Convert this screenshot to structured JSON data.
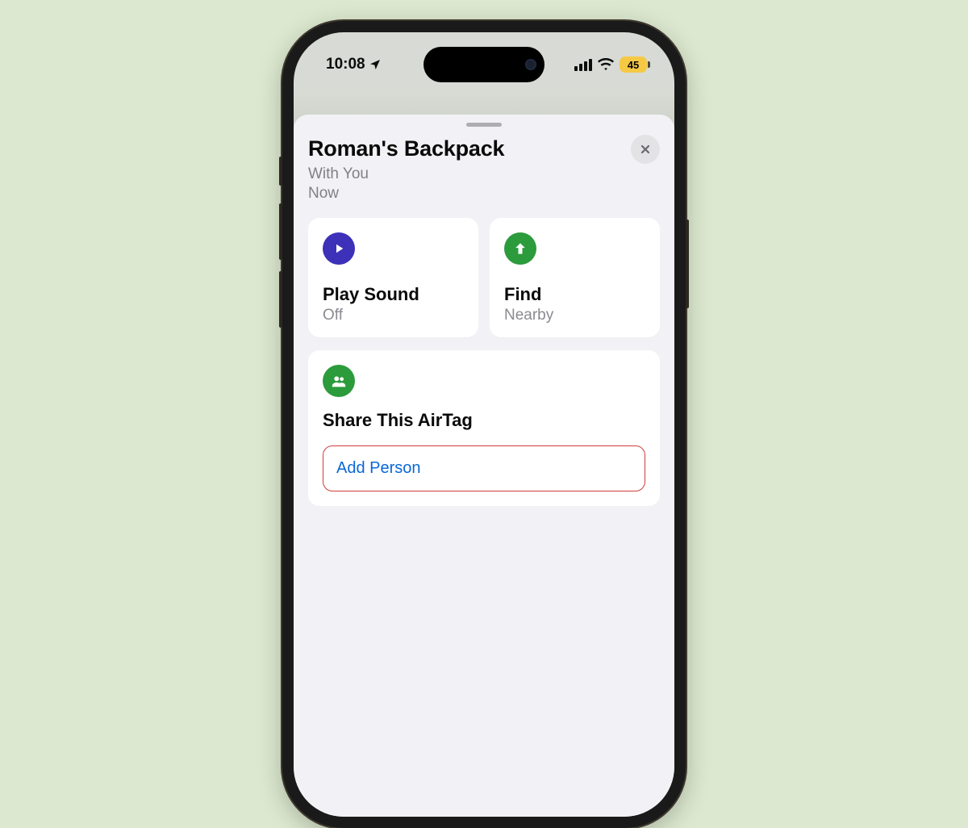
{
  "status": {
    "time": "10:08",
    "battery_percent": "45"
  },
  "sheet": {
    "title": "Roman's Backpack",
    "location_line1": "With You",
    "location_line2": "Now"
  },
  "tiles": {
    "play_sound": {
      "label": "Play Sound",
      "status": "Off"
    },
    "find": {
      "label": "Find",
      "status": "Nearby"
    }
  },
  "share": {
    "title": "Share This AirTag",
    "add_person": "Add Person"
  },
  "colors": {
    "tile_play_icon_bg": "#3c31b8",
    "tile_find_icon_bg": "#2b9b3b",
    "add_person_link": "#0a67d8",
    "add_person_border": "#d23b3b"
  }
}
